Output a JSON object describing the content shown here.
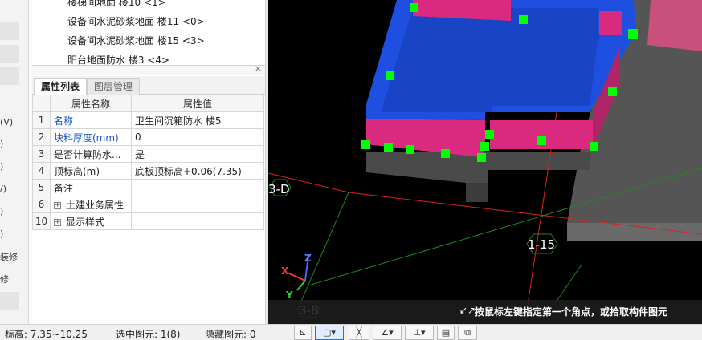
{
  "left_strip": {
    "labels": [
      "(V)",
      ")",
      ")",
      "/)",
      ")",
      ")",
      "装修",
      "修"
    ]
  },
  "tree": {
    "items": [
      "楼梯间地面 楼10 <1>",
      "设备间水泥砂浆地面 楼11 <0>",
      "设备间水泥砂浆地面 楼15 <3>",
      "阳台地面防水 楼3 <4>"
    ]
  },
  "props_panel": {
    "close_glyph": "×",
    "tabs": [
      {
        "label": "属性列表",
        "active": true
      },
      {
        "label": "图层管理",
        "active": false
      }
    ],
    "columns": {
      "name": "属性名称",
      "value": "属性值"
    },
    "rows": [
      {
        "idx": "1",
        "name": "名称",
        "value": "卫生间沉箱防水 楼5",
        "blue": true,
        "expand": false
      },
      {
        "idx": "2",
        "name": "块料厚度(mm)",
        "value": "0",
        "blue": true,
        "expand": false
      },
      {
        "idx": "3",
        "name": "是否计算防水...",
        "value": "是",
        "blue": false,
        "expand": false
      },
      {
        "idx": "4",
        "name": "顶标高(m)",
        "value": "底板顶标高+0.06(7.35)",
        "blue": false,
        "expand": false
      },
      {
        "idx": "5",
        "name": "备注",
        "value": "",
        "blue": false,
        "expand": false
      },
      {
        "idx": "6",
        "name": "土建业务属性",
        "value": "",
        "blue": false,
        "expand": true
      },
      {
        "idx": "10",
        "name": "显示样式",
        "value": "",
        "blue": false,
        "expand": true
      }
    ]
  },
  "viewport": {
    "axis_labels": {
      "a": "3-D",
      "b": "1-15",
      "c": "3-8"
    },
    "gizmo": {
      "x": "X",
      "y": "Y",
      "z": "Z"
    },
    "hint": "按鼠标左键指定第一个角点，或拾取构件图元",
    "hint_icon": "↙↗",
    "colors": {
      "blue": "#1f4fe0",
      "magenta": "#d92a7f",
      "grip": "#00ff00",
      "grid_red": "#e02020",
      "grid_green": "#1e8a1e"
    }
  },
  "status": {
    "elevation": "标高:  7.35~10.25",
    "selected": "选中图元: 1(8)",
    "hidden": "隐藏图元: 0"
  }
}
